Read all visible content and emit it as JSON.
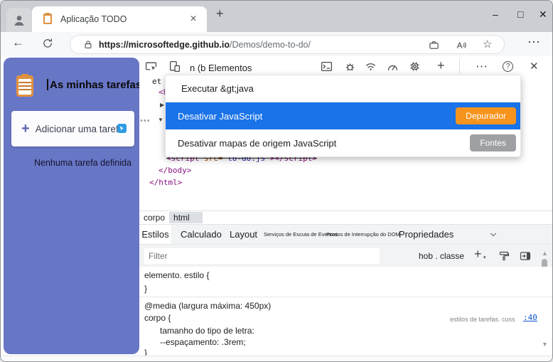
{
  "window_controls": {
    "minimize": "–",
    "maximize": "□",
    "close": "✕"
  },
  "browser_tab": {
    "title": "Aplicação TODO",
    "close": "✕",
    "new_tab": "+"
  },
  "address_bar": {
    "back": "←",
    "url_origin": "https://microsoftedge.github.io",
    "url_path": "/Demos/demo-to-do/",
    "star": "☆",
    "more": "⋯"
  },
  "todo_app": {
    "heading": "As minhas tarefas",
    "add_task_plus": "+",
    "add_task_label": "Adicionar uma tarefa",
    "empty_state": "Nenhuma tarefa definida",
    "sidebar_color": "#6876C6"
  },
  "devtools": {
    "toolbar": {
      "tab_text": "n (b Elementos",
      "more": "⋯",
      "help": "?",
      "close": "✕",
      "new_panel": "+"
    },
    "dom_tree": {
      "fragment_top": "et",
      "fragment_html_open": "<ht",
      "collapsed_arrow": "▶",
      "expanded_arrow": "▼",
      "overflow_dots": "•••",
      "script_open": "<script",
      "script_attr": " src=",
      "script_value": " to-do.js ",
      "script_close": "></script>",
      "body_close": "</body>",
      "html_close": "</html>"
    },
    "command_palette": {
      "query": "Executar &gt;java",
      "items": [
        {
          "label": "Desativar JavaScript",
          "badge": "Depurador"
        },
        {
          "label": "Desativar mapas de origem JavaScript",
          "badge": "Fontes"
        }
      ],
      "selected_color": "#1A73E8",
      "debugger_badge_color": "#F7941E",
      "sources_badge_color": "#9FA0A4"
    },
    "breadcrumb": [
      "corpo",
      "html"
    ],
    "panel_tabs": [
      "Estilos",
      "Calculado",
      "Layout",
      "Serviços de Escuta de Eventos",
      "Pontos de Interrupção do DOM",
      "Propriedades"
    ],
    "filter_bar": {
      "placeholder": "Filter",
      "pseudo_classes": "hob . classe"
    },
    "styles_pane": {
      "inline_rule_open": "elemento. estilo {",
      "inline_rule_close": "}",
      "media_query": "@media (largura máxima: 450px)",
      "body_rule_open": "corpo {",
      "stylesheet_ref": "estilos de tarefas. cuss",
      "line_ref": ":40",
      "declaration_font": "tamanho do tipo de letra:",
      "declaration_spacing": "--espaçamento: .3rem;",
      "body_rule_close": "}"
    }
  }
}
